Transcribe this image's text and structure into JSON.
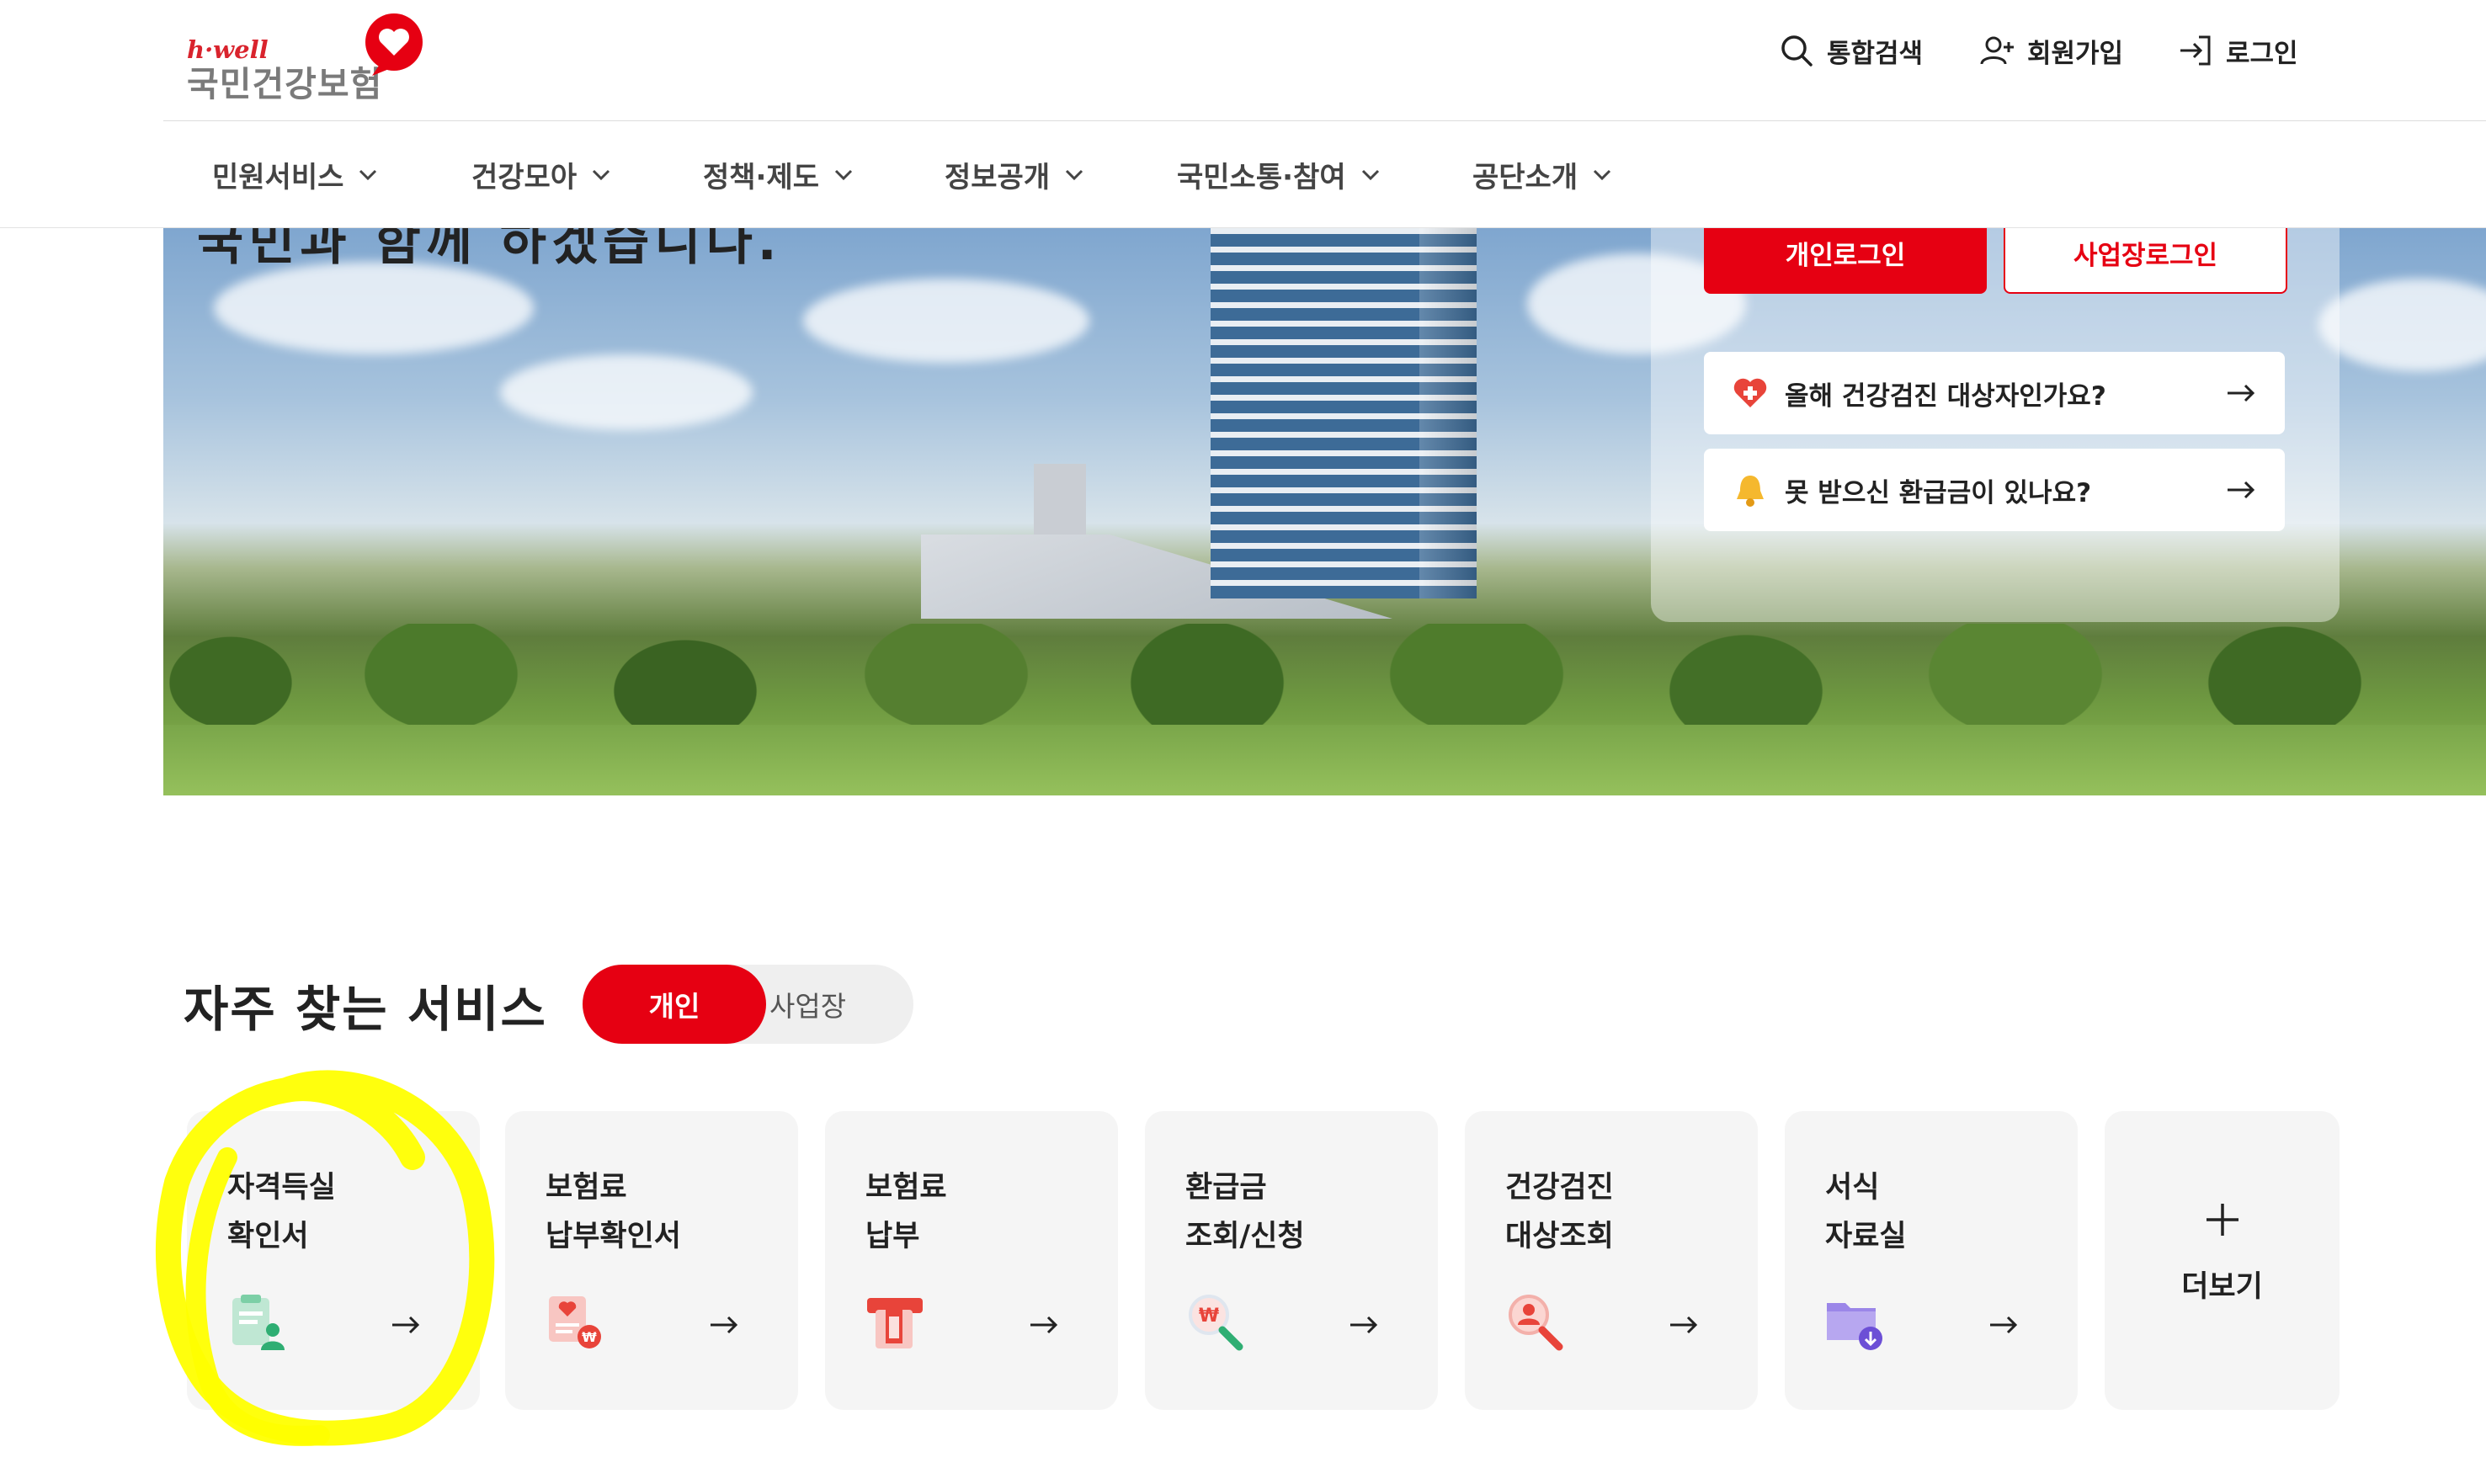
{
  "header": {
    "logo_small": "h·well",
    "logo_main": "국민건강보험",
    "util": [
      {
        "label": "통합검색",
        "icon": "search-icon"
      },
      {
        "label": "회원가입",
        "icon": "user-plus-icon"
      },
      {
        "label": "로그인",
        "icon": "login-icon"
      }
    ]
  },
  "nav": {
    "items": [
      "민원서비스",
      "건강모아",
      "정책·제도",
      "정보공개",
      "국민소통·참여",
      "공단소개"
    ]
  },
  "hero": {
    "partial_text": "국민과 함께 하겠습니다.",
    "login_personal": "개인로그인",
    "login_business": "사업장로그인",
    "quick_links": [
      {
        "label": "올해 건강검진 대상자인가요?",
        "icon": "heart-plus-icon"
      },
      {
        "label": "못 받으신 환급금이 있나요?",
        "icon": "bell-icon"
      }
    ]
  },
  "services": {
    "title": "자주 찾는 서비스",
    "tab_personal": "개인",
    "tab_business": "사업장",
    "cards": [
      {
        "line1": "자격득실",
        "line2": "확인서",
        "icon": "certificate-user-icon"
      },
      {
        "line1": "보험료",
        "line2": "납부확인서",
        "icon": "receipt-won-icon"
      },
      {
        "line1": "보험료",
        "line2": "납부",
        "icon": "card-payment-icon"
      },
      {
        "line1": "환급금",
        "line2": "조회/신청",
        "icon": "magnifier-won-icon"
      },
      {
        "line1": "건강검진",
        "line2": "대상조회",
        "icon": "magnifier-person-icon"
      },
      {
        "line1": "서식",
        "line2": "자료실",
        "icon": "folder-download-icon"
      }
    ],
    "more_label": "더보기"
  },
  "colors": {
    "brand_red": "#e60012",
    "annotation_yellow": "#ffff00"
  }
}
